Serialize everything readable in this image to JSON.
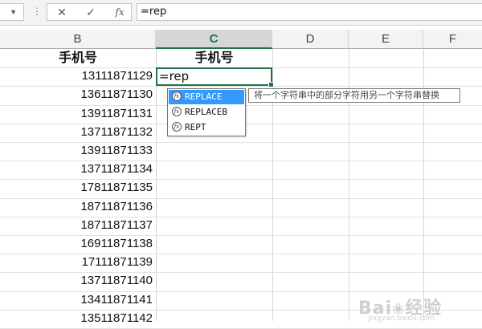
{
  "formula_bar": {
    "cancel_icon": "✕",
    "enter_icon": "✓",
    "fx_label": "fx",
    "content": "=rep"
  },
  "columns": [
    "B",
    "C",
    "D",
    "E",
    "F"
  ],
  "selected_column": "C",
  "header_row": {
    "b": "手机号",
    "c": "手机号"
  },
  "phone_numbers": [
    "13111871129",
    "13611871130",
    "13911871131",
    "13711871132",
    "13911871133",
    "13711871134",
    "17811871135",
    "18711871136",
    "18711871137",
    "16911871138",
    "17111871139",
    "13711871140",
    "13411871141",
    "13511871142"
  ],
  "active_cell": {
    "text": "=rep"
  },
  "autocomplete": {
    "items": [
      "REPLACE",
      "REPLACEB",
      "REPT"
    ],
    "selected_index": 0,
    "icon": "fx"
  },
  "tooltip": "将一个字符串中的部分字符用另一个字符串替换",
  "watermark": {
    "text": "Bai",
    "text2": "经验",
    "sub": "jingyan.baidu.com"
  },
  "colors": {
    "accent": "#217346",
    "selection": "#3399ff"
  }
}
